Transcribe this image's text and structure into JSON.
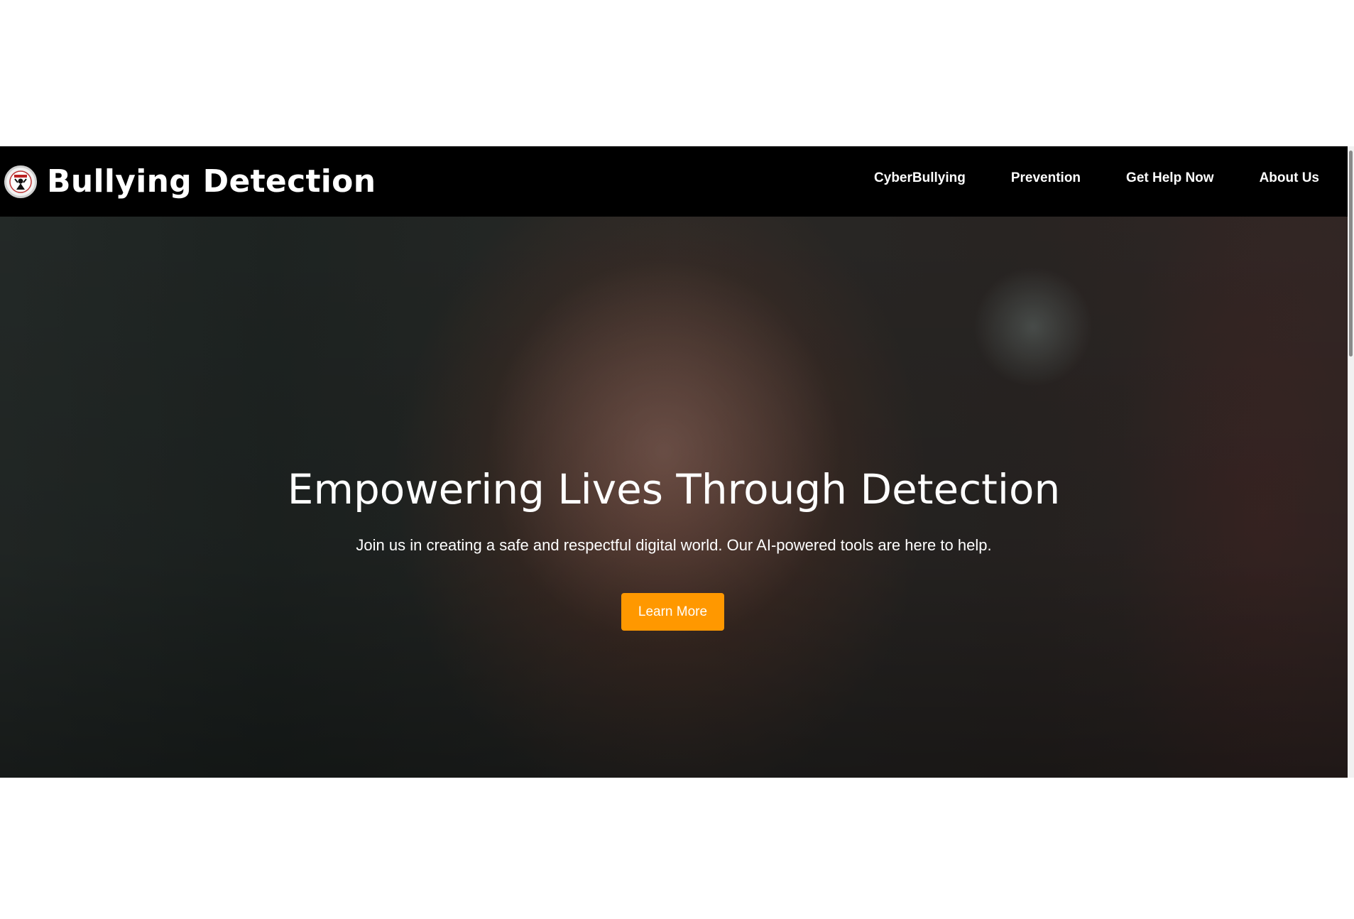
{
  "navbar": {
    "brand_title": "Bullying Detection",
    "logo_icon": "shield-figure-logo",
    "links": [
      {
        "label": "CyberBullying"
      },
      {
        "label": "Prevention"
      },
      {
        "label": "Get Help Now"
      },
      {
        "label": "About Us"
      }
    ]
  },
  "hero": {
    "title": "Empowering Lives Through Detection",
    "subtitle": "Join us in creating a safe and respectful digital world. Our AI-powered tools are here to help.",
    "cta_label": "Learn More"
  },
  "colors": {
    "navbar_bg": "#000000",
    "accent": "#ff9800",
    "text": "#ffffff"
  }
}
